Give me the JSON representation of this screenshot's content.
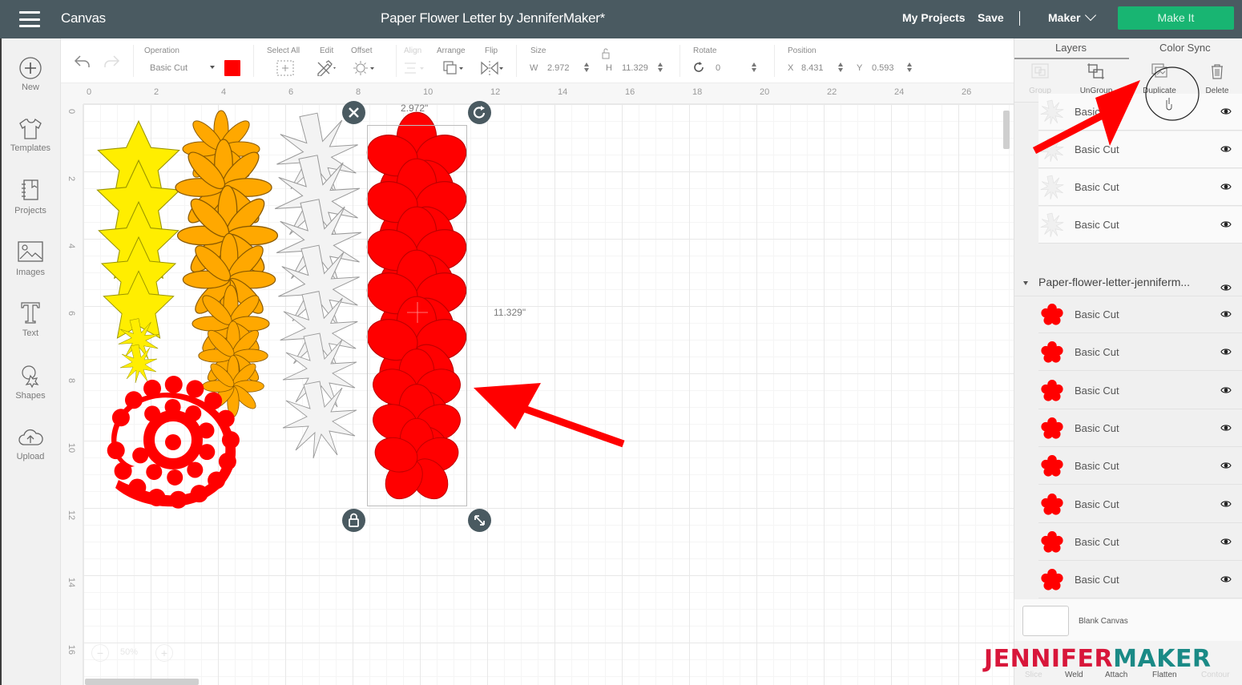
{
  "topbar": {
    "app_name": "Canvas",
    "document_title": "Paper Flower Letter by JenniferMaker*",
    "my_projects": "My Projects",
    "save": "Save",
    "machine": "Maker",
    "make_it": "Make It"
  },
  "leftnav": {
    "items": [
      {
        "label": "New",
        "icon": "plus-circle-icon"
      },
      {
        "label": "Templates",
        "icon": "tshirt-icon"
      },
      {
        "label": "Projects",
        "icon": "notebook-icon"
      },
      {
        "label": "Images",
        "icon": "image-icon"
      },
      {
        "label": "Text",
        "icon": "text-icon"
      },
      {
        "label": "Shapes",
        "icon": "shapes-icon"
      },
      {
        "label": "Upload",
        "icon": "cloud-upload-icon"
      }
    ]
  },
  "toolbar": {
    "operation_label": "Operation",
    "operation_value": "Basic Cut",
    "operation_color": "#ff0000",
    "select_all": "Select All",
    "edit": "Edit",
    "offset": "Offset",
    "align": "Align",
    "arrange": "Arrange",
    "flip": "Flip",
    "size_label": "Size",
    "w_label": "W",
    "w_value": "2.972",
    "h_label": "H",
    "h_value": "11.329",
    "rotate_label": "Rotate",
    "rotate_value": "0",
    "position_label": "Position",
    "x_label": "X",
    "x_value": "8.431",
    "y_label": "Y",
    "y_value": "0.593"
  },
  "canvas": {
    "ruler_top": [
      "0",
      "2",
      "4",
      "6",
      "8",
      "10",
      "12",
      "14",
      "16",
      "18",
      "20",
      "22",
      "24",
      "26"
    ],
    "ruler_left": [
      "0",
      "2",
      "4",
      "6",
      "8",
      "10",
      "12",
      "14",
      "16"
    ],
    "width_readout": "2.972\"",
    "height_readout": "11.329\"",
    "zoom_value": "50%",
    "zoom_out": "−",
    "zoom_in": "+"
  },
  "panel": {
    "tabs": [
      {
        "label": "Layers",
        "active": true
      },
      {
        "label": "Color Sync",
        "active": false
      }
    ],
    "tools": [
      {
        "label": "Group",
        "enabled": false
      },
      {
        "label": "UnGroup",
        "enabled": true
      },
      {
        "label": "Duplicate",
        "enabled": true
      },
      {
        "label": "Delete",
        "enabled": true
      }
    ],
    "layers_top": [
      {
        "name": "Basic Cut",
        "thumb": "white-star"
      },
      {
        "name": "Basic Cut",
        "thumb": "white-star"
      },
      {
        "name": "Basic Cut",
        "thumb": "white-star"
      },
      {
        "name": "Basic Cut",
        "thumb": "white-star"
      }
    ],
    "group_name": "Paper-flower-letter-jenniferm...",
    "group_layers": [
      {
        "name": "Basic Cut",
        "color": "#ff0000"
      },
      {
        "name": "Basic Cut",
        "color": "#ff0000"
      },
      {
        "name": "Basic Cut",
        "color": "#ff0000"
      },
      {
        "name": "Basic Cut",
        "color": "#ff0000"
      },
      {
        "name": "Basic Cut",
        "color": "#ff0000"
      },
      {
        "name": "Basic Cut",
        "color": "#ff0000"
      },
      {
        "name": "Basic Cut",
        "color": "#ff0000"
      },
      {
        "name": "Basic Cut",
        "color": "#ff0000"
      }
    ],
    "blank_canvas": "Blank Canvas",
    "bottom_tools": [
      {
        "label": "Slice",
        "enabled": false
      },
      {
        "label": "Weld",
        "enabled": true
      },
      {
        "label": "Attach",
        "enabled": true
      },
      {
        "label": "Flatten",
        "enabled": true
      },
      {
        "label": "Contour",
        "enabled": false
      }
    ]
  },
  "watermark": {
    "part1": "JENNIFER",
    "part2": "MAKER"
  },
  "colors": {
    "topbar": "#4a5a61",
    "make_it": "#18b572",
    "yellow_flowers": "#ffee00",
    "orange_flowers": "#ffa800",
    "red_flowers": "#ff0000",
    "annotation_arrow": "#ff0000"
  }
}
